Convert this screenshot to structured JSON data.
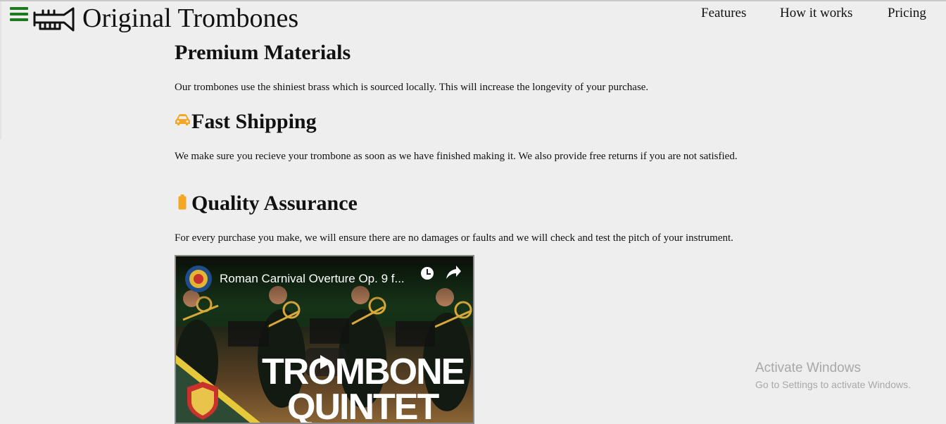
{
  "header": {
    "menu_icon": "hamburger-menu-icon",
    "logo_icon": "trumpet-logo-icon",
    "brand": "Original Trombones",
    "nav": [
      {
        "label": "Features"
      },
      {
        "label": "How it works"
      },
      {
        "label": "Pricing"
      }
    ]
  },
  "features": [
    {
      "icon": "",
      "heading": "Premium Materials",
      "text": "Our trombones use the shiniest brass which is sourced locally. This will increase the longevity of your purchase."
    },
    {
      "icon": "car-icon",
      "heading": "Fast Shipping",
      "text": "We make sure you recieve your trombone as soon as we have finished making it. We also provide free returns if you are not satisfied."
    },
    {
      "icon": "battery-icon",
      "heading": "Quality Assurance",
      "text": "For every purchase you make, we will ensure there are no damages or faults and we will check and test the pitch of your instrument."
    }
  ],
  "video": {
    "title": "Roman Carnival Overture Op. 9 f...",
    "overlay_line1": "TROMBONE",
    "overlay_line2": "QUINTET",
    "icons": [
      "channel-logo-icon",
      "watch-later-icon",
      "share-icon",
      "play-icon"
    ]
  },
  "watermark": {
    "title": "Activate Windows",
    "subtitle": "Go to Settings to activate Windows."
  },
  "colors": {
    "menu": "#1f7a1f",
    "feature_icon": "#f5a623",
    "background": "#eeeeee"
  }
}
